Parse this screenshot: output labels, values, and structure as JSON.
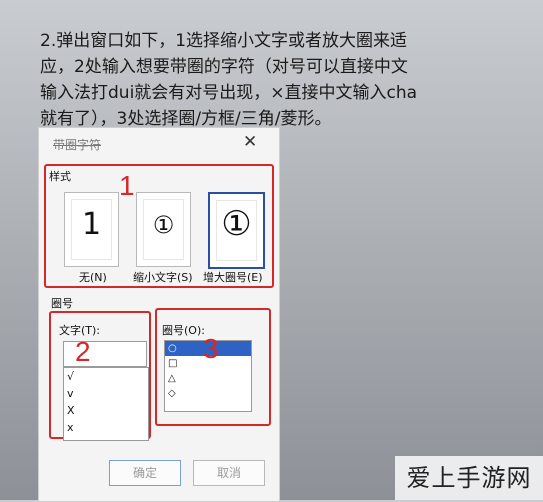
{
  "caption": {
    "line1": "2.弹出窗口如下，1选择缩小文字或者放大圈来适",
    "line2": "应，2处输入想要带圈的字符（对号可以直接中文",
    "line3": "输入法打dui就会有对号出现，×直接中文输入cha",
    "line4": "就有了），3处选择圈/方框/三角/菱形。"
  },
  "dialog": {
    "title": "带圈字符",
    "style_group": "样式",
    "styles": [
      {
        "glyph": "1",
        "label": "无(N)"
      },
      {
        "glyph": "①",
        "label": "缩小文字(S)"
      },
      {
        "glyph": "①",
        "label": "增大圈号(E)"
      }
    ],
    "selected_style": "增大圈号(E)",
    "circle_group": "圈号",
    "text_label": "文字(T):",
    "text_value": "",
    "text_items": [
      "√",
      "v",
      "X",
      "x"
    ],
    "enclosure_label": "圈号(O):",
    "enclosures": [
      "○",
      "□",
      "△",
      "◇"
    ],
    "selected_enclosure": "○",
    "ok_label": "确定",
    "cancel_label": "取消"
  },
  "annotations": [
    "1",
    "2",
    "3"
  ],
  "watermark": "爱上手游网"
}
